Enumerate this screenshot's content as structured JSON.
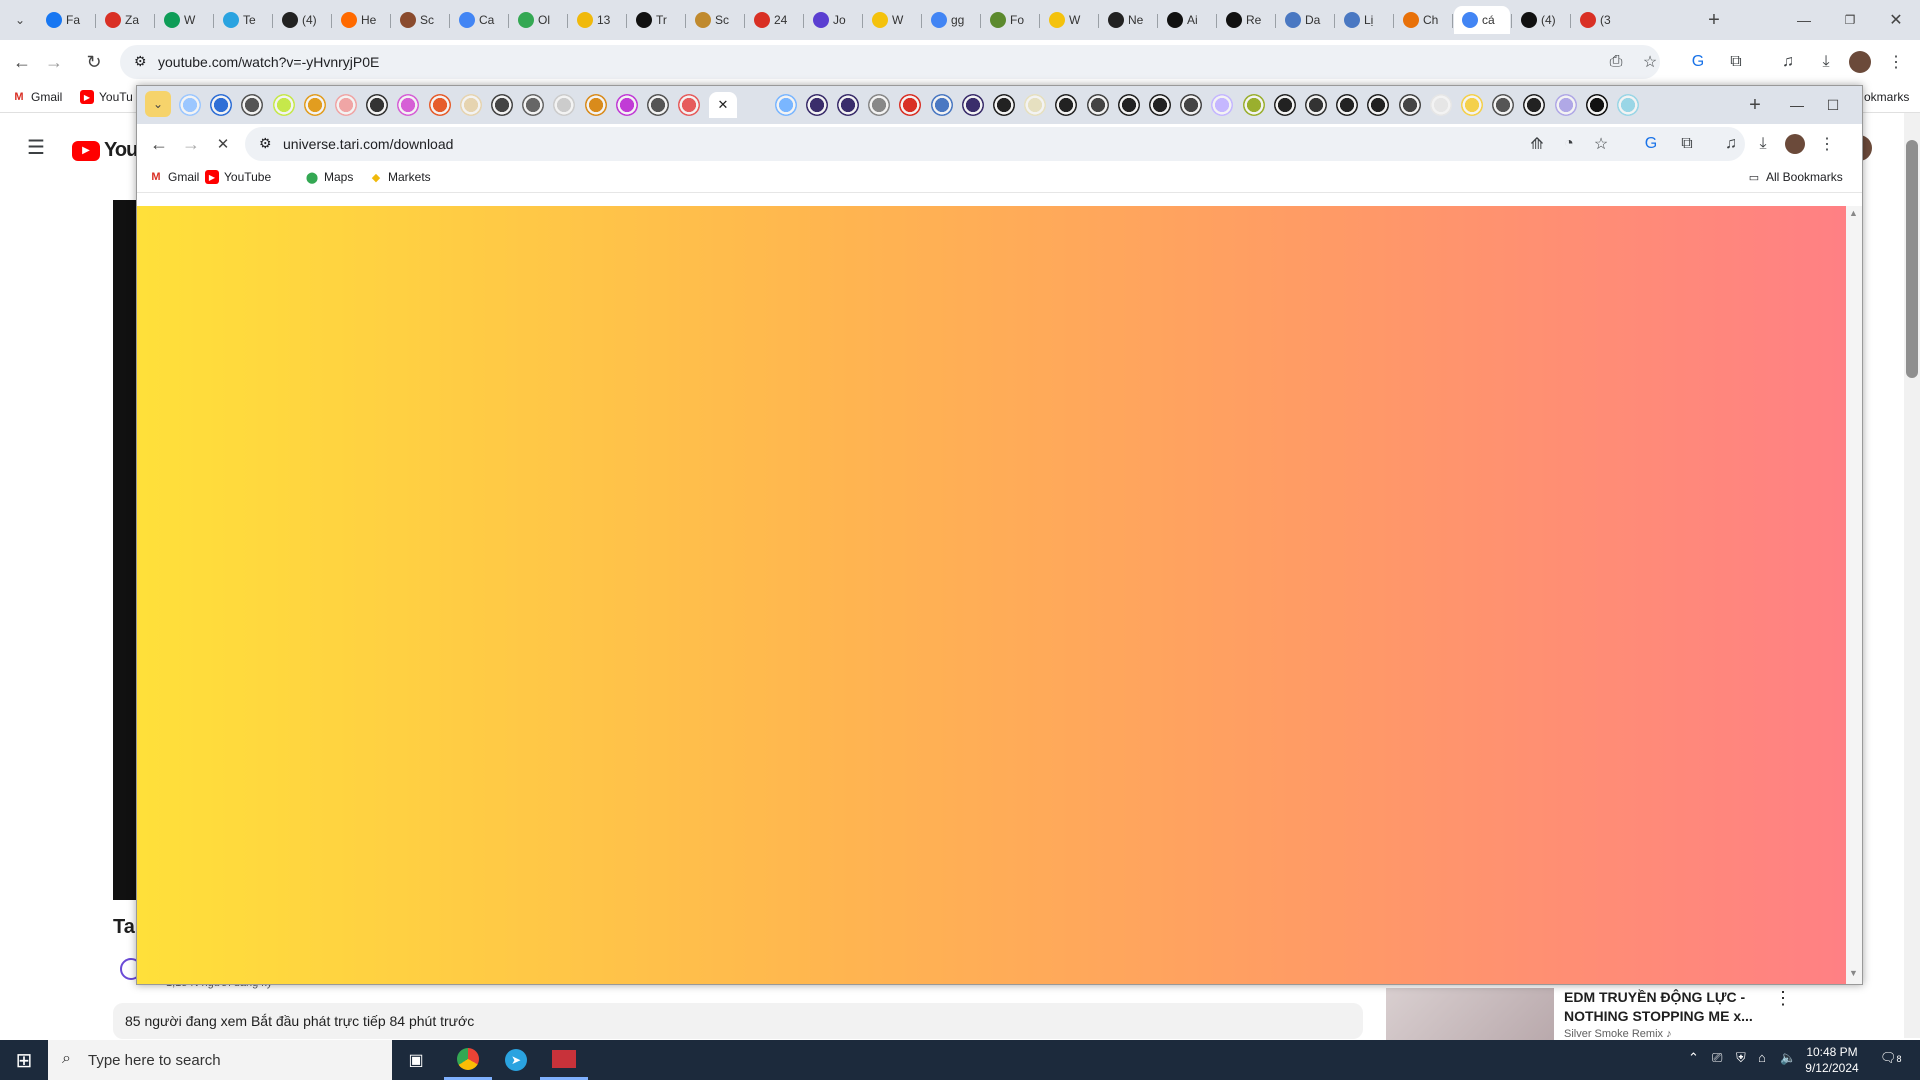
{
  "back_window": {
    "tabs": [
      {
        "label": "Fa",
        "color": "#1877f2"
      },
      {
        "label": "Za",
        "color": "#d93025"
      },
      {
        "label": "W",
        "color": "#0f9d58"
      },
      {
        "label": "Te",
        "color": "#2aa3e0"
      },
      {
        "label": "(4)",
        "color": "#222222"
      },
      {
        "label": "He",
        "color": "#ff6a00"
      },
      {
        "label": "Sc",
        "color": "#8a4b2e"
      },
      {
        "label": "Ca",
        "color": "#4285f4"
      },
      {
        "label": "Ol",
        "color": "#34a853"
      },
      {
        "label": "13",
        "color": "#f0b90b"
      },
      {
        "label": "Tr",
        "color": "#111111"
      },
      {
        "label": "Sc",
        "color": "#c08a2e"
      },
      {
        "label": "24",
        "color": "#d93025"
      },
      {
        "label": "Jo",
        "color": "#5b3fd1"
      },
      {
        "label": "W",
        "color": "#f4c20d"
      },
      {
        "label": "gg",
        "color": "#4285f4"
      },
      {
        "label": "Fo",
        "color": "#5c8a2e"
      },
      {
        "label": "W",
        "color": "#f4c20d"
      },
      {
        "label": "Ne",
        "color": "#222222"
      },
      {
        "label": "Ai",
        "color": "#111111"
      },
      {
        "label": "Re",
        "color": "#111111"
      },
      {
        "label": "Da",
        "color": "#4a78c2"
      },
      {
        "label": "Lị",
        "color": "#4a78c2"
      },
      {
        "label": "Ch",
        "color": "#e8710a"
      },
      {
        "label": "cá",
        "color": "#4285f4"
      },
      {
        "label": "(4)",
        "color": "#111111"
      },
      {
        "label": "(3",
        "color": "#d93025"
      }
    ],
    "new_tab": "+",
    "url": "youtube.com/watch?v=-yHvnryjP0E",
    "bookmarks": [
      "Gmail",
      "YouTu"
    ],
    "bookmarks_right": "okmarks"
  },
  "youtube": {
    "logo_text": "YouT",
    "title_partial": "Ta",
    "subscribers": "1,15 N người đăng ký",
    "live_info": "85 người đang xem  Bắt đầu phát trực tiếp 84 phút trước",
    "rec_title_line1": "EDM TRUYỀN ĐỘNG LỰC -",
    "rec_title_line2": "NOTHING STOPPING ME x...",
    "rec_channel": "Silver Smoke Remix ♪"
  },
  "front_window": {
    "url": "universe.tari.com/download",
    "bookmarks": [
      {
        "label": "Gmail",
        "icon": "gmail-icon"
      },
      {
        "label": "YouTube",
        "icon": "youtube-icon"
      },
      {
        "label": "Maps",
        "icon": "maps-icon"
      },
      {
        "label": "Markets",
        "icon": "markets-icon"
      }
    ],
    "all_bookmarks": "All Bookmarks",
    "tab_colors": [
      "#9cc7ff",
      "#2f6fd6",
      "#555555",
      "#c6e84b",
      "#e29d1f",
      "#f0a5a5",
      "#333333",
      "#d65fd6",
      "#e65c2b",
      "#e6d4b0",
      "#444444",
      "#666666",
      "#cccccc",
      "#d98b1b",
      "#c13bd6",
      "#555555",
      "#e65c5c",
      "#2aa3e0",
      "#7ab6ff",
      "#3a2d6b",
      "#3a2d6b",
      "#888888",
      "#d93025",
      "#4a78c2",
      "#3a2d6b",
      "#222222",
      "#e6e0c0",
      "#222222",
      "#444444",
      "#222222",
      "#222222",
      "#444444",
      "#c5b7ff",
      "#9aaf2e",
      "#222222",
      "#333333",
      "#222222",
      "#222222",
      "#444444",
      "#e6e6e6",
      "#f4d04b",
      "#555555",
      "#222222",
      "#b0a8e6",
      "#111111",
      "#9ad6e6"
    ],
    "new_tab": "+"
  },
  "taskbar": {
    "search_placeholder": "Type here to search",
    "time": "10:48 PM",
    "date": "9/12/2024",
    "notification_count": "8"
  }
}
